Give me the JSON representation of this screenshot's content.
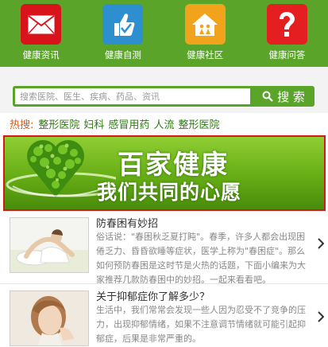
{
  "nav": [
    {
      "label": "健康资讯",
      "icon": "mail-icon",
      "color": "#d8131b"
    },
    {
      "label": "健康自测",
      "icon": "thumbs-up-icon",
      "color": "#2d8fd0"
    },
    {
      "label": "健康社区",
      "icon": "home-icon",
      "color": "#f1a31b"
    },
    {
      "label": "健康问答",
      "icon": "question-icon",
      "color": "#e51e22"
    }
  ],
  "search": {
    "placeholder": "搜索医院、医生、疾病、药品、资讯",
    "value": "",
    "button_label": "搜 索",
    "button_icon": "search-icon"
  },
  "hot": {
    "label": "热搜:",
    "tags": [
      "整形医院",
      "妇科",
      "感冒用药",
      "人流",
      "整形医院"
    ]
  },
  "banner": {
    "title": "百家健康",
    "subtitle": "我们共同的心愿",
    "art": "green-heart-tree"
  },
  "articles": [
    {
      "title": "防春困有妙招",
      "summary": "俗话说：\"春困秋乏夏打盹\"。春季，许多人都会出现困倦乏力、昏昏欲睡等症状，医学上称为\"春困症\"。那么如何预防春困是这时节是火热的话题，下面小编来为大家推荐几款防春困中的妙招。一起来看看吧。",
      "thumb": "woman-stretching-photo"
    },
    {
      "title": "关于抑郁症你了解多少？",
      "summary": "生活中，我们常常会发现一些人因为忍受不了竞争的压力，出现抑郁情绪，如果不注意调节情绪就可能引起抑郁症，后果是非常严重的。",
      "thumb": "sad-woman-photo"
    }
  ],
  "colors": {
    "brand_green": "#5aa42a",
    "hot_label": "#e05a10",
    "hot_tag": "#2f7a12",
    "banner_border": "#d9161b"
  }
}
